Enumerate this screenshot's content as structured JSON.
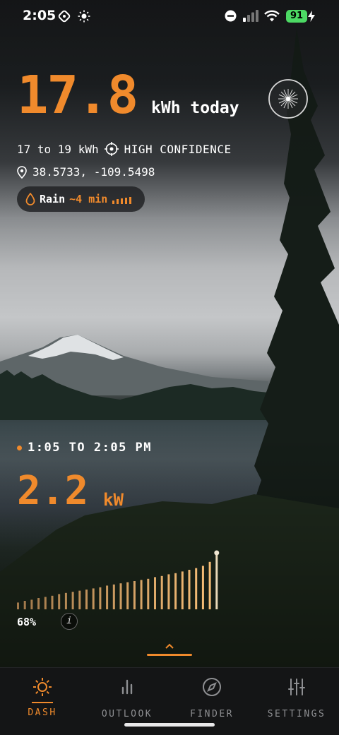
{
  "status_bar": {
    "time": "2:05",
    "battery": "91"
  },
  "energy": {
    "value": "17.8",
    "unit": "kWh today"
  },
  "forecast": {
    "range": "17 to 19 kWh",
    "confidence": "HIGH CONFIDENCE"
  },
  "location": {
    "coords": "38.5733, -109.5498"
  },
  "rain": {
    "label": "Rain",
    "eta": "~4 min"
  },
  "current": {
    "window": "1:05 TO 2:05 PM",
    "power": "2.2",
    "power_unit": "kW",
    "percent": "68%",
    "info": "i"
  },
  "power_history": {
    "levels": [
      0.12,
      0.15,
      0.17,
      0.2,
      0.22,
      0.24,
      0.27,
      0.29,
      0.31,
      0.33,
      0.35,
      0.37,
      0.39,
      0.42,
      0.44,
      0.46,
      0.48,
      0.5,
      0.52,
      0.54,
      0.57,
      0.59,
      0.62,
      0.64,
      0.67,
      0.7,
      0.73,
      0.77,
      0.84,
      1.0
    ]
  },
  "colors": {
    "accent": "#f08a2c",
    "battery": "#4cd964"
  },
  "tabs": [
    {
      "label": "DASH",
      "icon": "sun-icon",
      "active": true
    },
    {
      "label": "OUTLOOK",
      "icon": "bar-chart-icon",
      "active": false
    },
    {
      "label": "FINDER",
      "icon": "compass-icon",
      "active": false
    },
    {
      "label": "SETTINGS",
      "icon": "sliders-icon",
      "active": false
    }
  ]
}
